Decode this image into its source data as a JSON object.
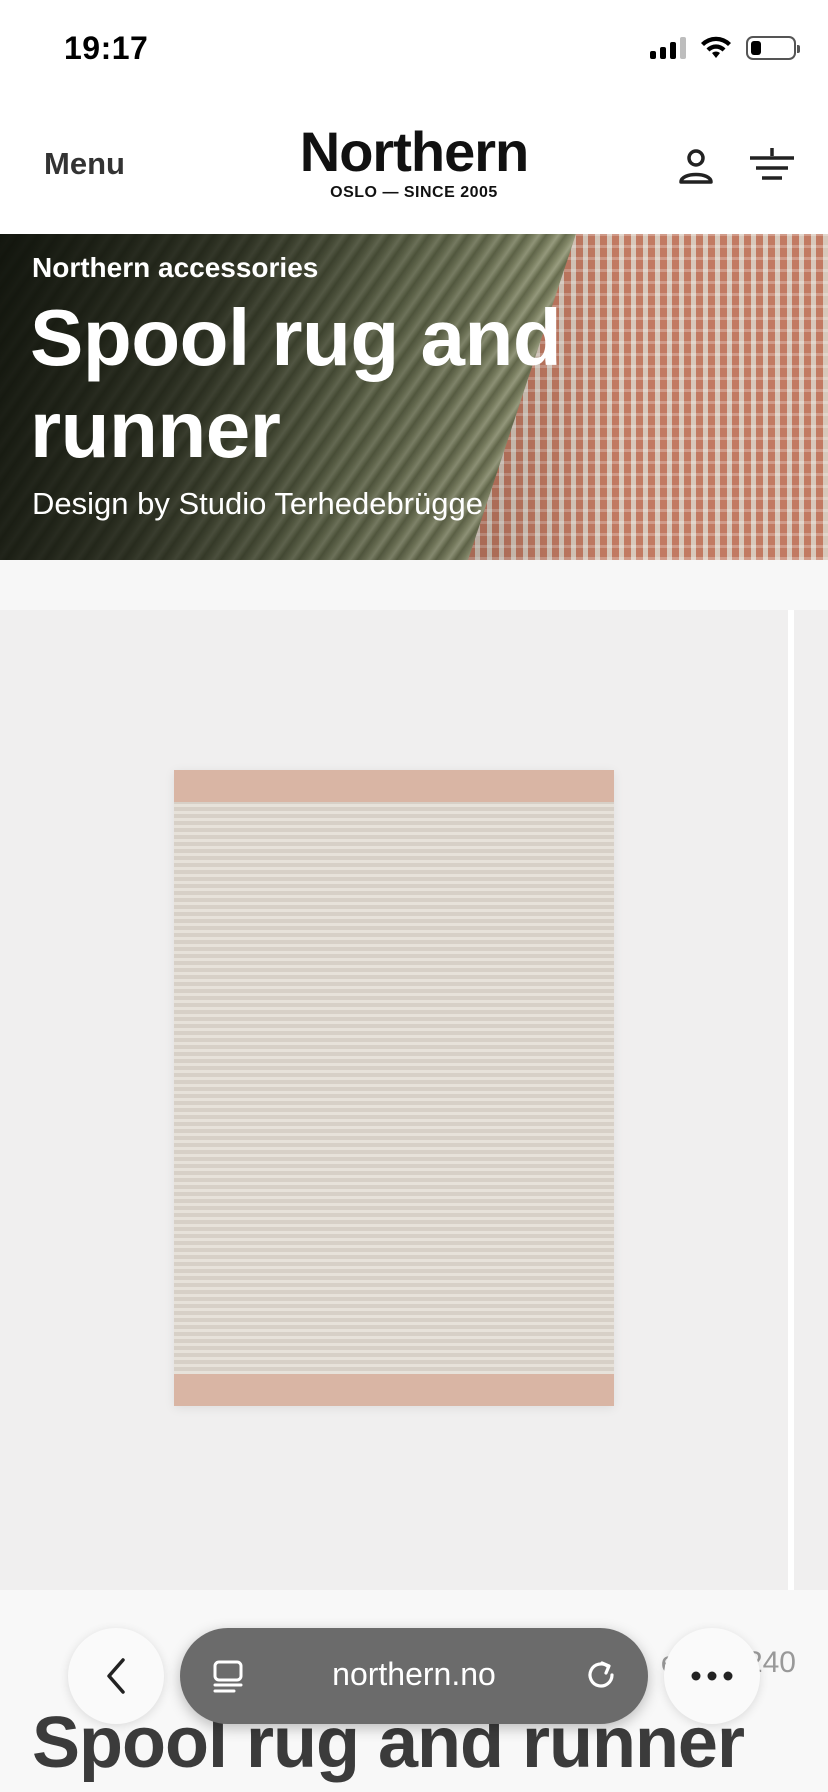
{
  "status": {
    "time": "19:17"
  },
  "header": {
    "menu_label": "Menu",
    "logo": "Northern",
    "logo_tagline": "OSLO — SINCE 2005"
  },
  "hero": {
    "eyebrow": "Northern accessories",
    "title": "Spool rug and runner",
    "designer": "Design by Studio Terhedebrügge"
  },
  "product": {
    "price_partial": "er / ... 240",
    "title": "Spool rug and runner"
  },
  "browser": {
    "url": "northern.no"
  },
  "icons": {
    "account": "account-icon",
    "basket": "basket-icon",
    "back": "chevron-left-icon",
    "tabs": "tabs-icon",
    "reload": "reload-icon",
    "more": "more-icon"
  }
}
